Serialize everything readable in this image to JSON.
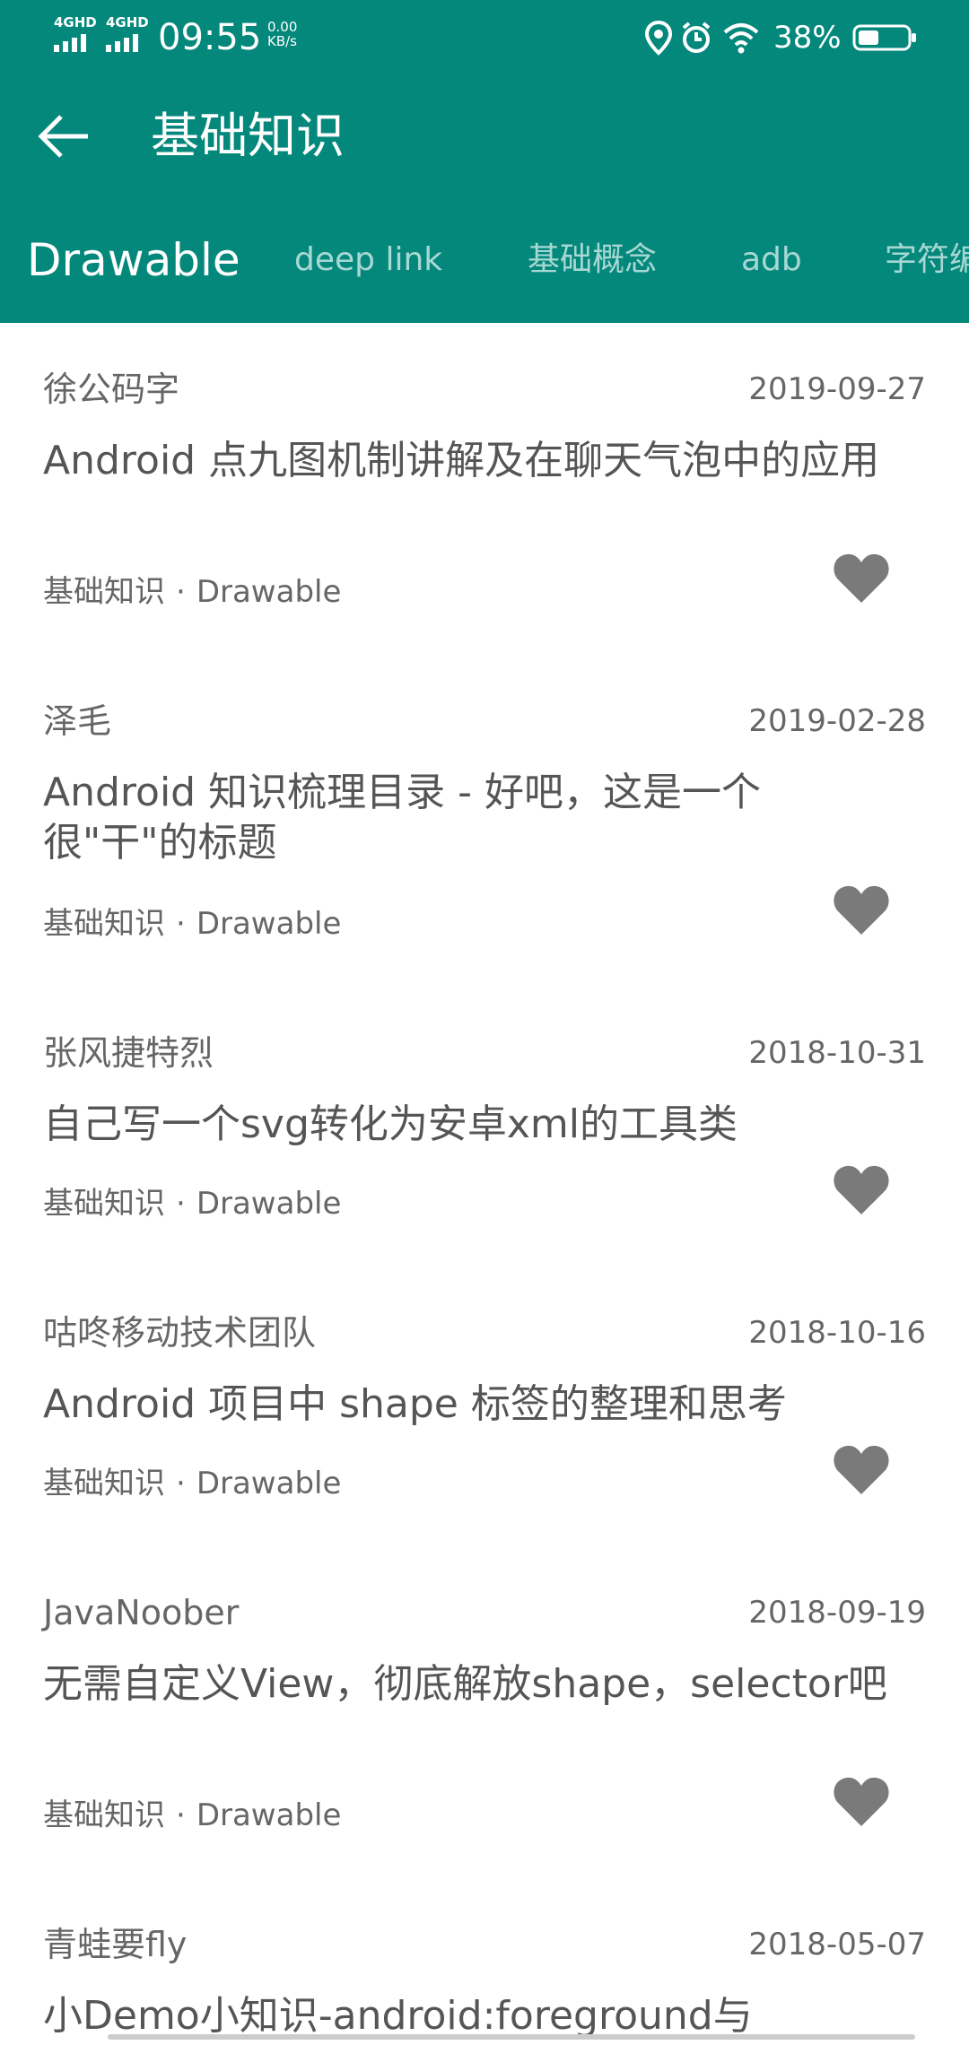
{
  "status_bar": {
    "network_1": "4GHD",
    "network_2": "4GHD",
    "time": "09:55",
    "speed_value": "0.00",
    "speed_unit": "KB/s",
    "battery_percent": "38%",
    "icons": [
      "location-icon",
      "alarm-icon",
      "wifi-icon",
      "battery-icon"
    ]
  },
  "toolbar": {
    "back_icon": "arrow-left-icon",
    "title": "基础知识"
  },
  "tabs": [
    {
      "label": "Drawable",
      "active": true
    },
    {
      "label": "deep link",
      "active": false
    },
    {
      "label": "基础概念",
      "active": false
    },
    {
      "label": "adb",
      "active": false
    },
    {
      "label": "字符编",
      "active": false
    }
  ],
  "articles": [
    {
      "author": "徐公码字",
      "date": "2019-09-27",
      "title": "Android 点九图机制讲解及在聊天气泡中的应用",
      "category": "基础知识",
      "separator": "·",
      "subcategory": "Drawable"
    },
    {
      "author": "泽毛",
      "date": "2019-02-28",
      "title": "Android 知识梳理目录 - 好吧，这是一个很\"干\"的标题",
      "category": "基础知识",
      "separator": "·",
      "subcategory": "Drawable"
    },
    {
      "author": "张风捷特烈",
      "date": "2018-10-31",
      "title": "自己写一个svg转化为安卓xml的工具类",
      "category": "基础知识",
      "separator": "·",
      "subcategory": "Drawable"
    },
    {
      "author": "咕咚移动技术团队",
      "date": "2018-10-16",
      "title": "Android 项目中 shape 标签的整理和思考",
      "category": "基础知识",
      "separator": "·",
      "subcategory": "Drawable"
    },
    {
      "author": "JavaNoober",
      "date": "2018-09-19",
      "title": "无需自定义View，彻底解放shape，selector吧",
      "category": "基础知识",
      "separator": "·",
      "subcategory": "Drawable"
    },
    {
      "author": "青蛙要fly",
      "date": "2018-05-07",
      "title": "小Demo小知识-android:foreground与",
      "category": "",
      "separator": "",
      "subcategory": ""
    }
  ],
  "colors": {
    "primary": "#05887c",
    "tab_inactive": "#a8d8d3",
    "heart": "#7a7a7a",
    "text_secondary": "#666666"
  }
}
